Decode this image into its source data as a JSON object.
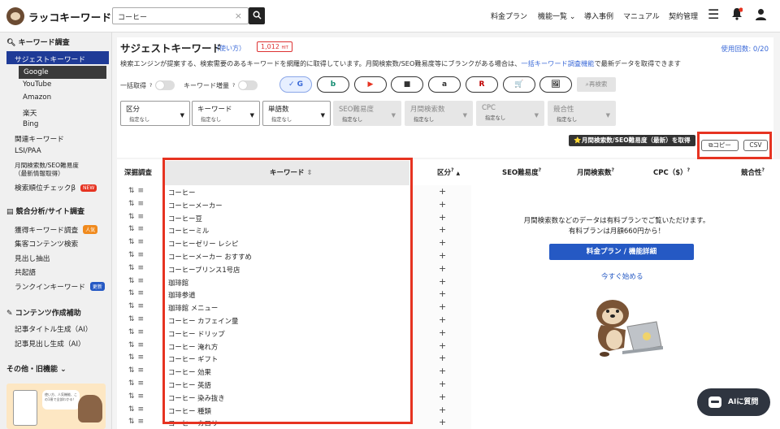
{
  "brand": {
    "name": "ラッコキーワード"
  },
  "search": {
    "value": "コーヒー",
    "clear": "×"
  },
  "nav": {
    "pricing": "料金プラン",
    "features": "機能一覧",
    "cases": "導入事例",
    "manual": "マニュアル",
    "contract": "契約管理"
  },
  "sidebar": {
    "sec1": "キーワード調査",
    "suggest": "サジェストキーワード",
    "engines": [
      "Google",
      "YouTube",
      "Amazon",
      "楽天",
      "Bing"
    ],
    "items1": [
      "関連キーワード",
      "LSI/PAA",
      "月間検索数/SEO難易度",
      "（最新情報取得）",
      "検索順位チェックβ"
    ],
    "new_badge": "NEW",
    "sec2": "競合分析/サイト調査",
    "items2": [
      "獲得キーワード調査",
      "集客コンテンツ検索",
      "見出し抽出",
      "共起語",
      "ランクインキーワード"
    ],
    "popular_badge": "人気",
    "update_badge": "更新",
    "sec3": "コンテンツ作成補助",
    "items3": [
      "記事タイトル生成（AI）",
      "記事見出し生成（AI）"
    ],
    "sec4": "その他・旧機能"
  },
  "page": {
    "title": "サジェストキーワード",
    "usage": "（使い方）",
    "hits": "1,012",
    "hits_unit": "HIT",
    "count": "使用回数: 0/20",
    "desc_a": "検索エンジンが提案する、検索需要のあるキーワードを網羅的に取得しています。月間検索数/SEO難易度等にブランクがある場合は、",
    "desc_link": "一括キーワード調査機能",
    "desc_b": "で最新データを取得できます",
    "toggle_bulk": "一括取得",
    "toggle_inc": "キーワード増量",
    "engine_btns": [
      "✓ G",
      "b",
      "▶",
      "■",
      "a",
      "R",
      "🛒",
      "🖼"
    ],
    "research": "再検索",
    "filters": [
      {
        "label": "区分",
        "sub": "指定なし"
      },
      {
        "label": "キーワード",
        "sub": "指定なし"
      },
      {
        "label": "単語数",
        "sub": "指定なし"
      },
      {
        "label": "SEO難易度",
        "sub": "指定なし"
      },
      {
        "label": "月間検索数",
        "sub": "指定なし"
      },
      {
        "label": "CPC",
        "sub": "指定なし"
      },
      {
        "label": "競合性",
        "sub": "指定なし"
      }
    ],
    "get_btn": "⭐月間検索数/SEO難易度（最新）を取得",
    "copy": "コピー",
    "csv": "CSV"
  },
  "table": {
    "headers": {
      "deep": "深掘調査",
      "keyword": "キーワード",
      "kubun": "区分",
      "seo": "SEO難易度",
      "vol": "月間検索数",
      "cpc": "CPC（$）",
      "comp": "競合性"
    },
    "rows": [
      "コーヒー",
      "コーヒーメーカー",
      "コーヒー豆",
      "コーヒーミル",
      "コーヒーゼリー レシピ",
      "コーヒーメーカー おすすめ",
      "コーヒープリンス1号店",
      "珈琲館",
      "珈琲参道",
      "珈琲館 メニュー",
      "コーヒー カフェイン量",
      "コーヒー ドリップ",
      "コーヒー 淹れ方",
      "コーヒー ギフト",
      "コーヒー 効果",
      "コーヒー 英語",
      "コーヒー 染み抜き",
      "コーヒー 種類",
      "コーヒー カロリー"
    ],
    "paid_1": "月間検索数などのデータは有料プランでご覧いただけます。",
    "paid_2": "有料プランは月額660円から！",
    "paid_btn": "料金プラン / 機能詳細",
    "start": "今すぐ始める"
  },
  "ai_button": "AIに質問",
  "ad": {
    "text": "使い方、人気機能、この1冊で全部わかる！"
  },
  "colors": {
    "accent": "#1f3b97",
    "highlight": "#e63321",
    "link": "#3b6ad8"
  }
}
